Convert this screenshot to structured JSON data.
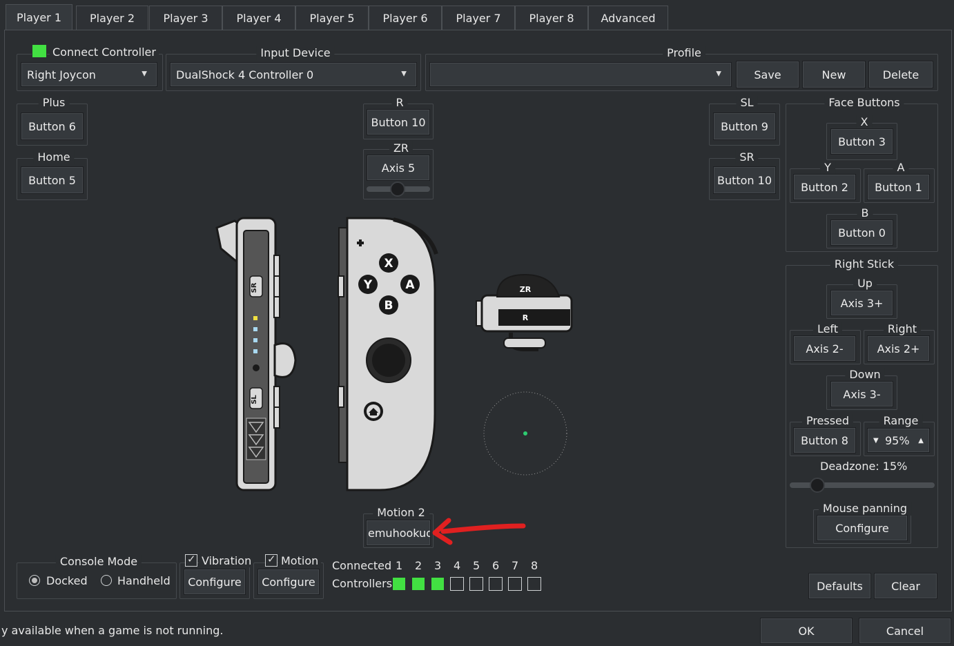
{
  "tabs": [
    "Player 1",
    "Player 2",
    "Player 3",
    "Player 4",
    "Player 5",
    "Player 6",
    "Player 7",
    "Player 8",
    "Advanced"
  ],
  "connect": {
    "label": "Connect Controller",
    "controller_type": "Right Joycon"
  },
  "input_device": {
    "label": "Input Device",
    "value": "DualShock 4 Controller 0"
  },
  "profile": {
    "label": "Profile",
    "value": "",
    "save": "Save",
    "new": "New",
    "delete": "Delete"
  },
  "buttons": {
    "plus": {
      "label": "Plus",
      "value": "Button 6"
    },
    "home": {
      "label": "Home",
      "value": "Button 5"
    },
    "r": {
      "label": "R",
      "value": "Button 10"
    },
    "zr": {
      "label": "ZR",
      "value": "Axis 5"
    },
    "sl": {
      "label": "SL",
      "value": "Button 9"
    },
    "sr": {
      "label": "SR",
      "value": "Button 10"
    }
  },
  "face_buttons": {
    "label": "Face Buttons",
    "x": {
      "label": "X",
      "value": "Button 3"
    },
    "y": {
      "label": "Y",
      "value": "Button 2"
    },
    "a": {
      "label": "A",
      "value": "Button 1"
    },
    "b": {
      "label": "B",
      "value": "Button 0"
    }
  },
  "right_stick": {
    "label": "Right Stick",
    "up": {
      "label": "Up",
      "value": "Axis 3+"
    },
    "left": {
      "label": "Left",
      "value": "Axis 2-"
    },
    "right": {
      "label": "Right",
      "value": "Axis 2+"
    },
    "down": {
      "label": "Down",
      "value": "Axis 3-"
    },
    "pressed": {
      "label": "Pressed",
      "value": "Button 8"
    },
    "range": {
      "label": "Range",
      "value": "95%"
    },
    "deadzone": "Deadzone: 15%",
    "mouse_panning": {
      "label": "Mouse panning",
      "button": "Configure"
    }
  },
  "motion2": {
    "label": "Motion 2",
    "value": "emuhookud"
  },
  "console_mode": {
    "label": "Console Mode",
    "docked": "Docked",
    "handheld": "Handheld"
  },
  "vibration": {
    "label": "Vibration",
    "configure": "Configure"
  },
  "motion": {
    "label": "Motion",
    "configure": "Configure"
  },
  "connected": {
    "label1": "Connected",
    "label2": "Controllers",
    "numbers": [
      "1",
      "2",
      "3",
      "4",
      "5",
      "6",
      "7",
      "8"
    ],
    "states": [
      true,
      true,
      true,
      false,
      false,
      false,
      false,
      false
    ]
  },
  "defaults": "Defaults",
  "clear": "Clear",
  "status_text": "y available when a game is not running.",
  "ok": "OK",
  "cancel": "Cancel",
  "joycon_labels": {
    "sr": "SR",
    "sl": "SL",
    "x": "X",
    "y": "Y",
    "a": "A",
    "b": "B",
    "zr": "ZR",
    "r": "R"
  },
  "colors": {
    "accent_green": "#42e042",
    "annotation_arrow": "#e02020"
  }
}
